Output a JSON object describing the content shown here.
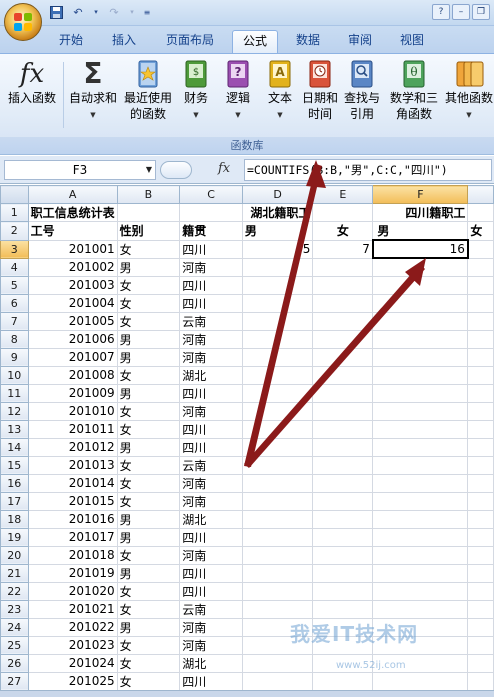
{
  "tabs": [
    "开始",
    "插入",
    "页面布局",
    "公式",
    "数据",
    "审阅",
    "视图"
  ],
  "active_tab": "公式",
  "ribbon": {
    "buttons": [
      {
        "label": "插入函数",
        "icon": "fx-icon"
      },
      {
        "label": "自动求和",
        "icon": "sigma-icon"
      },
      {
        "label": "最近使用的函数",
        "icon": "recent-functions-icon"
      },
      {
        "label": "财务",
        "icon": "financial-book-icon"
      },
      {
        "label": "逻辑",
        "icon": "logical-book-icon"
      },
      {
        "label": "文本",
        "icon": "text-book-icon"
      },
      {
        "label": "日期和时间",
        "icon": "datetime-book-icon"
      },
      {
        "label": "查找与引用",
        "icon": "lookup-book-icon"
      },
      {
        "label": "数学和三角函数",
        "icon": "math-book-icon"
      },
      {
        "label": "其他函数",
        "icon": "more-functions-icon"
      }
    ],
    "group_label": "函数库",
    "fx_glyph": "fx",
    "sigma_glyph": "Σ"
  },
  "formula_bar": {
    "name_box": "F3",
    "fx_label": "fx",
    "formula": "=COUNTIFS(B:B,\"男\",C:C,\"四川\")"
  },
  "columns": [
    "A",
    "B",
    "C",
    "D",
    "E",
    "F"
  ],
  "rows": [
    {
      "n": "1",
      "a": "职工信息统计表",
      "b": "",
      "c": "",
      "d": "湖北籍职工",
      "e": "",
      "f": "四川籍职工"
    },
    {
      "n": "2",
      "a": "工号",
      "b": "性别",
      "c": "籍贯",
      "d": "男",
      "e": "女",
      "f": "男",
      "g": "女"
    },
    {
      "n": "3",
      "a": "",
      "b": "",
      "c": "四川",
      "d": "5",
      "e": "7",
      "f": "16"
    },
    {
      "n": "4",
      "a": "201002",
      "b": "男",
      "c": "河南"
    },
    {
      "n": "5",
      "a": "201003",
      "b": "女",
      "c": "四川"
    },
    {
      "n": "6",
      "a": "201004",
      "b": "女",
      "c": "四川"
    },
    {
      "n": "7",
      "a": "201005",
      "b": "女",
      "c": "云南"
    },
    {
      "n": "8",
      "a": "201006",
      "b": "男",
      "c": "河南"
    },
    {
      "n": "9",
      "a": "201007",
      "b": "男",
      "c": "河南"
    },
    {
      "n": "10",
      "a": "201008",
      "b": "女",
      "c": "湖北"
    },
    {
      "n": "11",
      "a": "201009",
      "b": "男",
      "c": "四川"
    },
    {
      "n": "12",
      "a": "201010",
      "b": "女",
      "c": "河南"
    },
    {
      "n": "13",
      "a": "201011",
      "b": "女",
      "c": "四川"
    },
    {
      "n": "14",
      "a": "201012",
      "b": "男",
      "c": "四川"
    },
    {
      "n": "15",
      "a": "201013",
      "b": "女",
      "c": "云南"
    },
    {
      "n": "16",
      "a": "201014",
      "b": "女",
      "c": "河南"
    },
    {
      "n": "17",
      "a": "201015",
      "b": "女",
      "c": "河南"
    },
    {
      "n": "18",
      "a": "201016",
      "b": "男",
      "c": "湖北"
    },
    {
      "n": "19",
      "a": "201017",
      "b": "男",
      "c": "四川"
    },
    {
      "n": "20",
      "a": "201018",
      "b": "女",
      "c": "河南"
    },
    {
      "n": "21",
      "a": "201019",
      "b": "男",
      "c": "四川"
    },
    {
      "n": "22",
      "a": "201020",
      "b": "女",
      "c": "四川"
    },
    {
      "n": "23",
      "a": "201021",
      "b": "女",
      "c": "云南"
    },
    {
      "n": "24",
      "a": "201022",
      "b": "男",
      "c": "河南"
    },
    {
      "n": "25",
      "a": "201023",
      "b": "女",
      "c": "河南"
    },
    {
      "n": "26",
      "a": "201024",
      "b": "女",
      "c": "湖北"
    },
    {
      "n": "27",
      "a": "201025",
      "b": "女",
      "c": "四川"
    }
  ],
  "row3_a": "201001",
  "row3_b": "女",
  "watermark": "我爱IT技术网",
  "watermark_url": "www.52ij.com",
  "colors": {
    "accent": "#15428b",
    "arrow": "#8b1a1a",
    "selection_header": "#f2bd58"
  }
}
